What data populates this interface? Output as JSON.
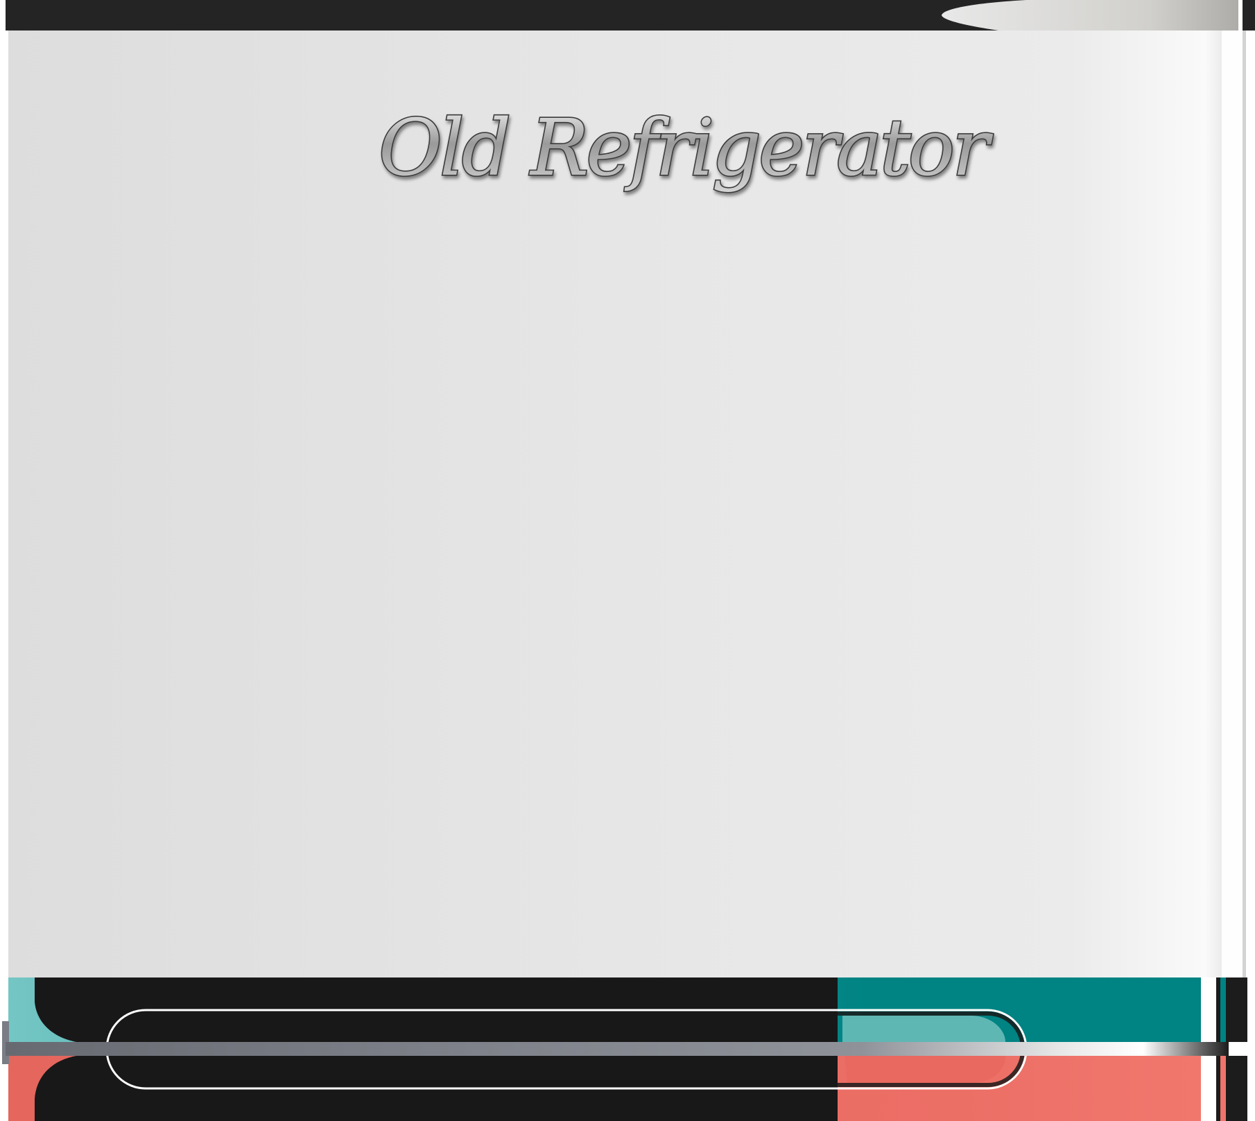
{
  "fridge": {
    "title": "Old Refrigerator"
  },
  "colors": {
    "top_bar": "#242424",
    "body_light": "#e7e7e7",
    "body_shadow": "#dcdcdc",
    "teal": "#008383",
    "teal_light": "#6dc6c4",
    "coral": "#ef746b",
    "coral_dark": "#e6675e",
    "dark_panel": "#181818",
    "chrome": "#7a7d85"
  },
  "icons": {
    "handle": "chrome-handle-icon",
    "logo": "script-logo"
  }
}
